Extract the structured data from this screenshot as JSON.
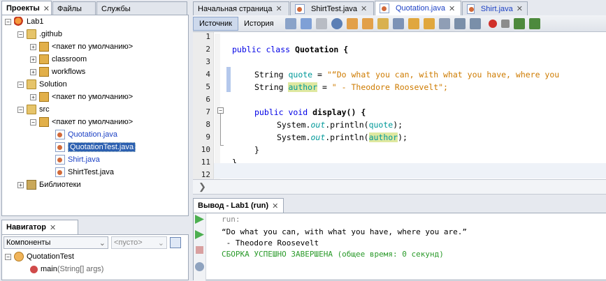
{
  "projects_panel": {
    "tabs": [
      "Проекты",
      "Файлы",
      "Службы"
    ],
    "tree": [
      {
        "label": "Lab1",
        "icon": "project-icon",
        "expander": "−"
      },
      {
        "label": ".github",
        "icon": "folder-icon",
        "expander": "−"
      },
      {
        "label": "<пакет по умолчанию>",
        "icon": "package-icon",
        "expander": "+"
      },
      {
        "label": "classroom",
        "icon": "package-icon",
        "expander": "+"
      },
      {
        "label": "workflows",
        "icon": "package-icon",
        "expander": "+"
      },
      {
        "label": "Solution",
        "icon": "folder-icon",
        "expander": "−"
      },
      {
        "label": "<пакет по умолчанию>",
        "icon": "package-icon",
        "expander": "+"
      },
      {
        "label": "src",
        "icon": "folder-icon",
        "expander": "−"
      },
      {
        "label": "<пакет по умолчанию>",
        "icon": "package-icon",
        "expander": "−"
      },
      {
        "label": "Quotation.java",
        "icon": "java-file-icon"
      },
      {
        "label": "QuotationTest.java",
        "icon": "java-file-icon"
      },
      {
        "label": "Shirt.java",
        "icon": "java-file-icon"
      },
      {
        "label": "ShirtTest.java",
        "icon": "java-file-icon"
      },
      {
        "label": "Библиотеки",
        "icon": "library-icon",
        "expander": "+"
      }
    ]
  },
  "navigator": {
    "title": "Навигатор",
    "filter_value": "Компоненты",
    "filter2_value": "<пусто>",
    "class_name": "QuotationTest",
    "method": "main",
    "method_params": "(String[] args)"
  },
  "editor": {
    "tabs": [
      "Начальная страница",
      "ShirtTest.java",
      "Quotation.java",
      "Shirt.java"
    ],
    "active_tab": "Quotation.java",
    "toolbar": {
      "source": "Источник",
      "history": "История"
    },
    "line_numbers": [
      "1",
      "2",
      "3",
      "4",
      "5",
      "6",
      "7",
      "8",
      "9",
      "10",
      "11",
      "12"
    ],
    "code": {
      "l2a": "public class",
      "l2b": " Quotation {",
      "l4a": "String ",
      "l4b": "quote",
      " l4c": "",
      "l4d": " = ",
      "l4e": "\"“Do what you can, with what you have, where you",
      "l5a": "String ",
      "l5b": "author",
      "l5c": " = ",
      "l5d": "\" - Theodore Roosevelt\";",
      "l7a": "public void",
      "l7b": " display() {",
      "l8a": "System.",
      "l8b": "out",
      "l8c": ".println(",
      "l8d": "quote",
      "l8e": ");",
      "l9a": "System.",
      "l9b": "out",
      "l9c": ".println(",
      "l9d": "author",
      "l9e": ");",
      "l10": "}",
      "l11": "}"
    }
  },
  "output": {
    "title": "Вывод - Lab1 (run)",
    "lines": [
      "run:",
      "“Do what you can, with what you have, where you are.”",
      " - Theodore Roosevelt",
      "СБОРКА УСПЕШНО ЗАВЕРШЕНА (общее время: 0 секунд)"
    ],
    "colors": {
      "run": "#888888",
      "text": "#000000",
      "success": "#2a9a2a"
    }
  }
}
